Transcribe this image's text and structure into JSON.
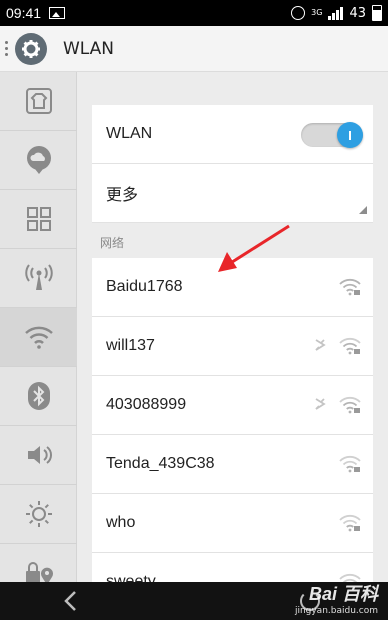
{
  "status_bar": {
    "time": "09:41",
    "network_type": "3G",
    "battery_level": "43"
  },
  "title_bar": {
    "title": "WLAN"
  },
  "wlan_toggle": {
    "label": "WLAN",
    "state": "on",
    "accent_color": "#2e9fe2"
  },
  "more_row": {
    "label": "更多"
  },
  "networks_section": {
    "header": "网络",
    "items": [
      {
        "ssid": "Baidu1768",
        "icon": "wifi-locked-icon",
        "sharing": false
      },
      {
        "ssid": "will137",
        "icon": "wifi-locked-icon",
        "sharing": true
      },
      {
        "ssid": "403088999",
        "icon": "wifi-locked-icon",
        "sharing": true
      },
      {
        "ssid": "Tenda_439C38",
        "icon": "wifi-locked-icon",
        "sharing": false
      },
      {
        "ssid": "who",
        "icon": "wifi-locked-icon",
        "sharing": false
      },
      {
        "ssid": "sweety",
        "icon": "wifi-locked-icon",
        "sharing": false
      }
    ]
  },
  "left_rail": {
    "items": [
      {
        "icon": "theme-shirt-icon",
        "active": false
      },
      {
        "icon": "cloud-chat-icon",
        "active": false
      },
      {
        "icon": "grid-apps-icon",
        "active": false
      },
      {
        "icon": "antenna-signal-icon",
        "active": false
      },
      {
        "icon": "wifi-icon",
        "active": true
      },
      {
        "icon": "bluetooth-icon",
        "active": false
      },
      {
        "icon": "volume-icon",
        "active": false
      },
      {
        "icon": "brightness-icon",
        "active": false
      },
      {
        "icon": "lock-location-icon",
        "active": false
      }
    ]
  },
  "watermark": {
    "logo": "Bai 百科",
    "url": "jingyan.baidu.com"
  }
}
